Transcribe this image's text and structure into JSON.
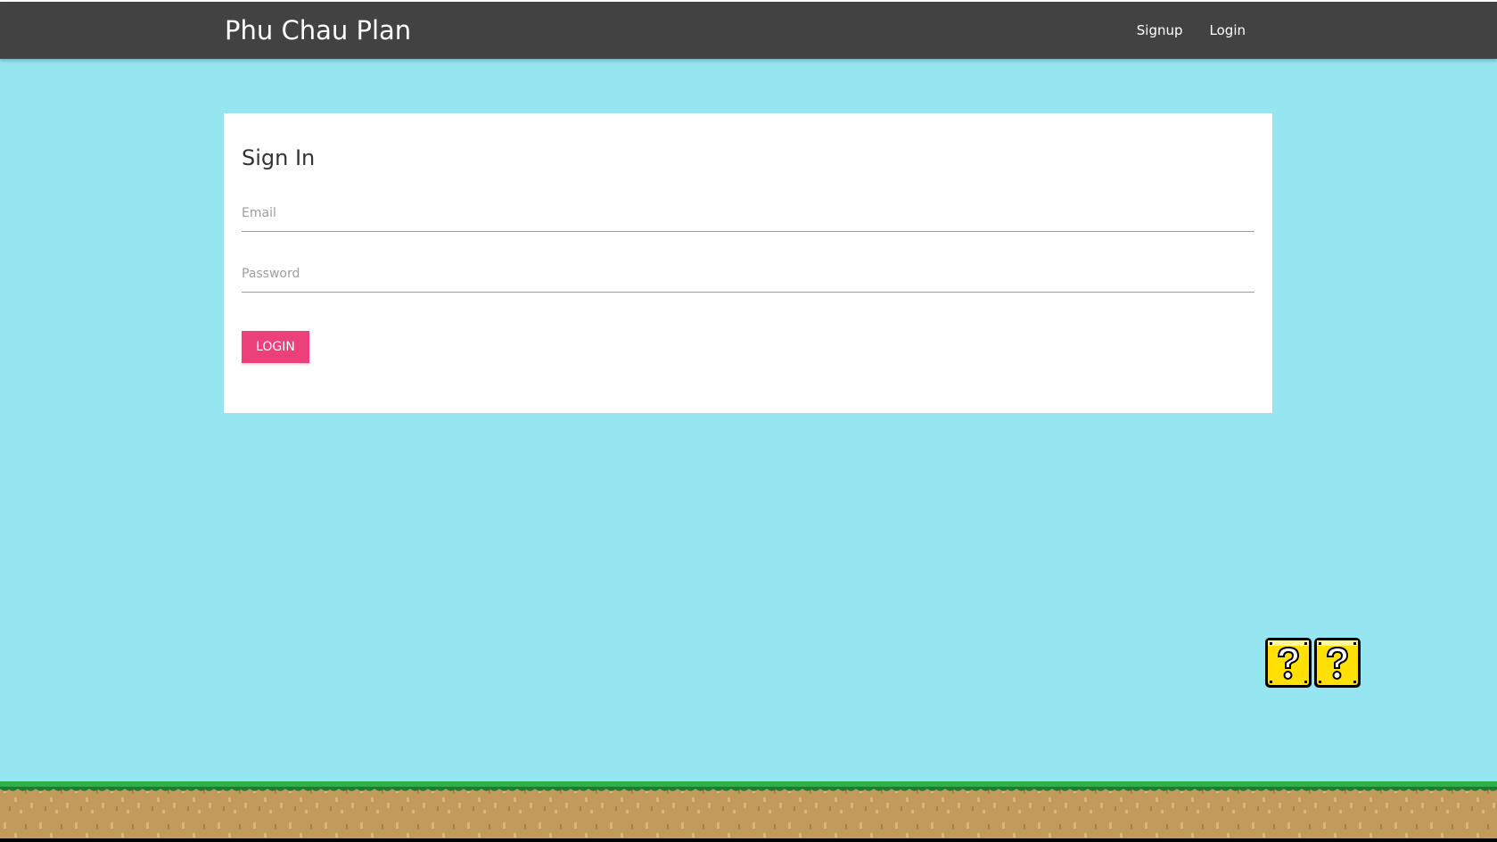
{
  "brand": {
    "title": "Phu Chau Plan"
  },
  "nav": {
    "items": [
      {
        "label": "Signup"
      },
      {
        "label": "Login"
      }
    ]
  },
  "signin": {
    "title": "Sign In",
    "email": {
      "placeholder": "Email",
      "value": ""
    },
    "password": {
      "placeholder": "Password",
      "value": ""
    },
    "submit_label": "LOGIN"
  },
  "colors": {
    "navbar": "#424242",
    "background": "#96e6f2",
    "accent": "#ec407a",
    "block": "#ffe000",
    "grass": "#2fb14a",
    "dirt": "#c29a5c"
  },
  "decorations": {
    "question_blocks": [
      {
        "icon": "question-block-icon"
      },
      {
        "icon": "question-block-icon"
      }
    ],
    "ground_icon": "grass-ground-icon"
  }
}
